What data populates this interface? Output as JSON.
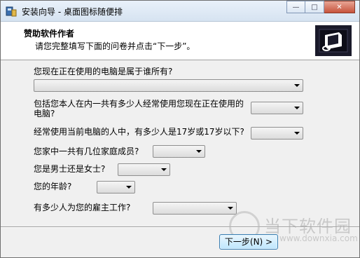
{
  "window": {
    "title": "安装向导 - 桌面图标随便排",
    "controls": {
      "minimize": "—",
      "maximize": "□",
      "close": "✕"
    }
  },
  "header": {
    "title": "赞助软件作者",
    "subtitle": "请您完整填写下面的问卷并点击“下一步”。"
  },
  "questions": [
    {
      "label": "您现在正在使用的电脑是属于谁所有?",
      "value": ""
    },
    {
      "label_line1": "包括您本人在内一共有多少人经常使用您现在正在使用的",
      "label_line2": "电脑?",
      "value": ""
    },
    {
      "label": "经常使用当前电脑的人中，有多少人是17岁或17岁以下?",
      "value": ""
    },
    {
      "label": "您家中一共有几位家庭成员?",
      "value": ""
    },
    {
      "label": "您是男士还是女士?",
      "value": ""
    },
    {
      "label": "您的年龄?",
      "value": ""
    },
    {
      "label": "有多少人为您的雇主工作?",
      "value": ""
    }
  ],
  "buttons": {
    "next": "下一步(N) >"
  },
  "watermark": {
    "text": "当下软件园",
    "url": "www.downxia.com"
  }
}
